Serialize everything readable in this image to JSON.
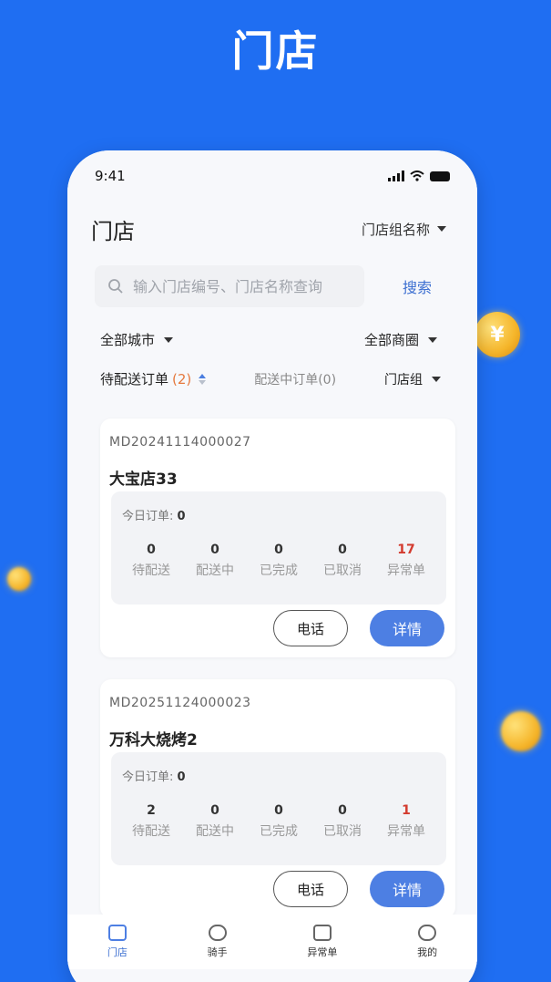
{
  "hero": {
    "title": "门店"
  },
  "coin_symbol": "¥",
  "status_bar": {
    "time": "9:41"
  },
  "header": {
    "title": "门店",
    "group_select": "门店组名称"
  },
  "search": {
    "placeholder": "输入门店编号、门店名称查询",
    "button": "搜索"
  },
  "filters": {
    "city": "全部城市",
    "area": "全部商圈"
  },
  "tabs": {
    "pending_label": "待配送订单",
    "pending_count": "(2)",
    "delivering": "配送中订单(0)",
    "group": "门店组"
  },
  "stores": [
    {
      "code": "MD20241114000027",
      "name": "大宝店33",
      "today_label": "今日订单:",
      "today_value": "0",
      "stats": [
        {
          "value": "0",
          "label": "待配送"
        },
        {
          "value": "0",
          "label": "配送中"
        },
        {
          "value": "0",
          "label": "已完成"
        },
        {
          "value": "0",
          "label": "已取消"
        },
        {
          "value": "17",
          "label": "异常单"
        }
      ],
      "phone_label": "电话",
      "detail_label": "详情"
    },
    {
      "code": "MD20251124000023",
      "name": "万科大烧烤2",
      "today_label": "今日订单:",
      "today_value": "0",
      "stats": [
        {
          "value": "2",
          "label": "待配送"
        },
        {
          "value": "0",
          "label": "配送中"
        },
        {
          "value": "0",
          "label": "已完成"
        },
        {
          "value": "0",
          "label": "已取消"
        },
        {
          "value": "1",
          "label": "异常单"
        }
      ],
      "phone_label": "电话",
      "detail_label": "详情"
    }
  ],
  "tabbar": [
    {
      "label": "门店",
      "icon": "store-icon"
    },
    {
      "label": "骑手",
      "icon": "scooter-icon"
    },
    {
      "label": "异常单",
      "icon": "clipboard-icon"
    },
    {
      "label": "我的",
      "icon": "user-icon"
    }
  ],
  "colors": {
    "background": "#1f6ef2",
    "accent": "#4d7fe3",
    "alert": "#d33b2f",
    "count": "#e5793e"
  }
}
